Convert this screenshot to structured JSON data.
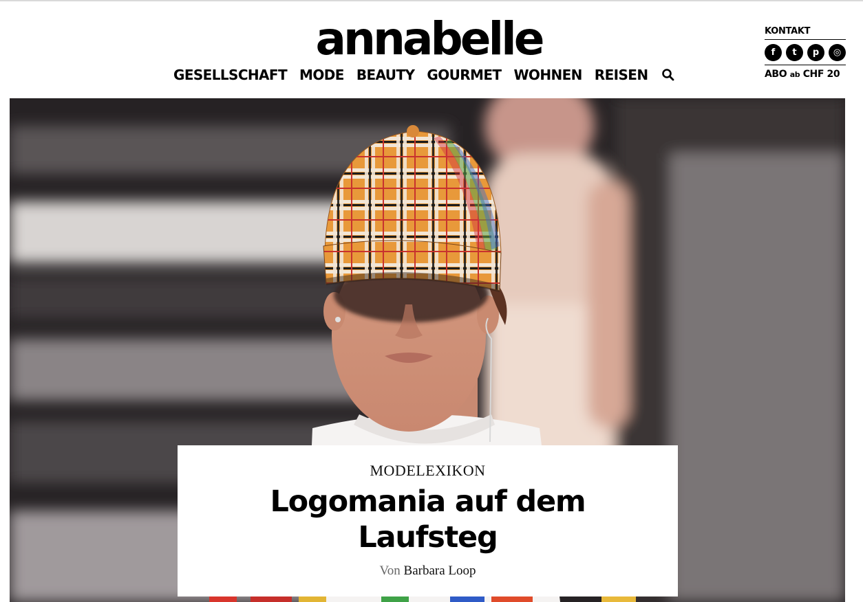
{
  "header": {
    "logo": "annabelle",
    "nav": [
      "GESELLSCHAFT",
      "MODE",
      "BEAUTY",
      "GOURMET",
      "WOHNEN",
      "REISEN"
    ],
    "search_icon": "search-icon"
  },
  "utility": {
    "kontakt": "KONTAKT",
    "social": [
      {
        "name": "facebook-icon",
        "glyph": "f"
      },
      {
        "name": "twitter-icon",
        "glyph": "t"
      },
      {
        "name": "pinterest-icon",
        "glyph": "p"
      },
      {
        "name": "instagram-icon",
        "glyph": "◎"
      }
    ],
    "abo_prefix": "ABO",
    "abo_ab": "ab",
    "abo_price": "CHF 20"
  },
  "article": {
    "kicker": "MODELEXIKON",
    "title": "Logomania auf dem Laufsteg",
    "byline_prefix": "Von",
    "author": "Barbara Loop"
  },
  "colors": {
    "text": "#000000",
    "hero_dark": "#2a2426",
    "cap_orange": "#e89a3c"
  }
}
